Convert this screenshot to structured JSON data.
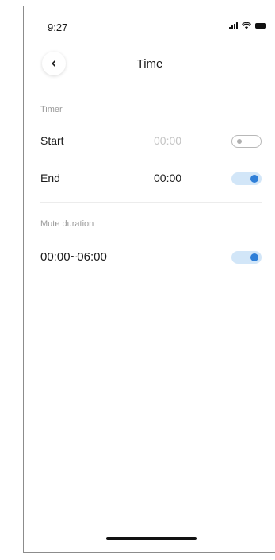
{
  "status_bar": {
    "time": "9:27",
    "icons": [
      "signal-icon",
      "wifi-icon",
      "battery-icon"
    ]
  },
  "header": {
    "back_icon": "chevron-left-icon",
    "title": "Time"
  },
  "timer_section": {
    "label": "Timer",
    "rows": [
      {
        "label": "Start",
        "value": "00:00",
        "enabled": false
      },
      {
        "label": "End",
        "value": "00:00",
        "enabled": true
      }
    ]
  },
  "mute_section": {
    "label": "Mute duration",
    "range": "00:00~06:00",
    "enabled": true
  },
  "colors": {
    "accent": "#2f7fd8",
    "toggle_on_track": "#d2e6f8",
    "muted_text": "#9a9a9a",
    "disabled_value": "#c4c4c4"
  }
}
